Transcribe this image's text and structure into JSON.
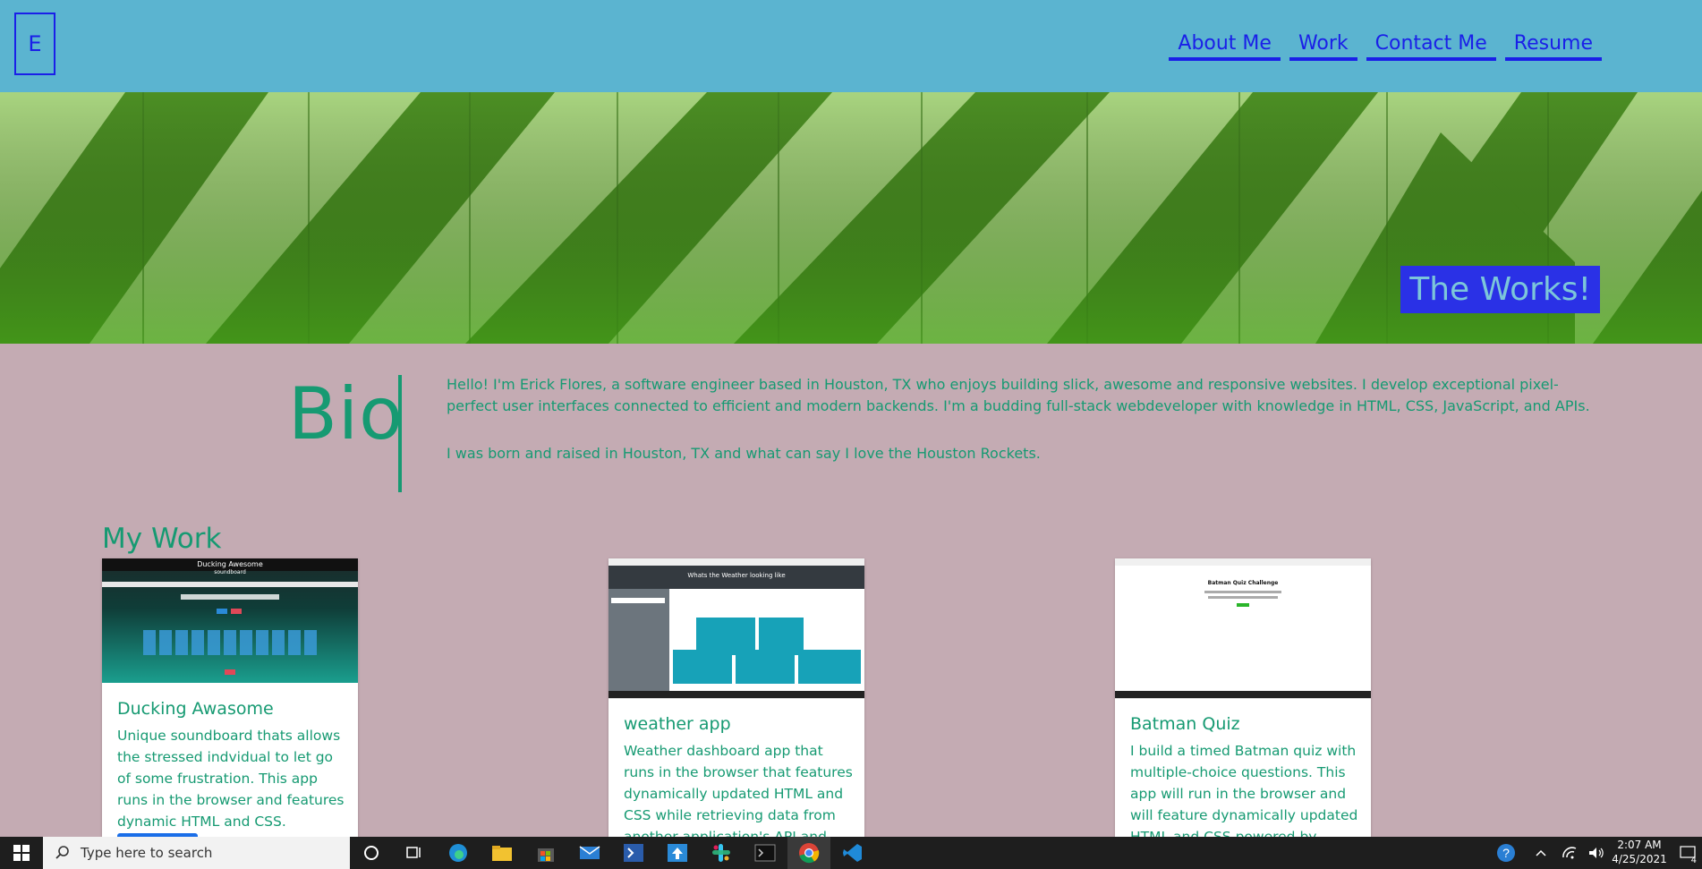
{
  "header": {
    "logo": "E",
    "nav": [
      "About Me",
      "Work",
      "Contact Me",
      "Resume"
    ]
  },
  "hero": {
    "title": "The Works!"
  },
  "bio": {
    "heading": "Bio",
    "paragraphs": [
      "Hello! I'm Erick Flores, a software engineer based in Houston, TX who enjoys building slick, awesome and responsive websites. I develop exceptional pixel-perfect user interfaces connected to efficient and modern backends. I'm a budding full-stack webdeveloper with knowledge in HTML, CSS, JavaScript, and APIs.",
      "I was born and raised in Houston, TX and what can say I love the Houston Rockets."
    ]
  },
  "work": {
    "heading": "My Work",
    "projects": [
      {
        "title": "Ducking Awasome",
        "description": "Unique soundboard thats allows the stressed indvidual to let go of some frustration. This app runs in the browser and features dynamic HTML and CSS.",
        "thumb": {
          "title": "Ducking Awesome",
          "subtitle": "soundboard"
        }
      },
      {
        "title": "weather app",
        "description": "Weather dashboard app that runs in the browser that features dynamically updated HTML and CSS while retrieving data from another application's API and using it in the",
        "thumb": {
          "title": "Whats the Weather looking like"
        }
      },
      {
        "title": "Batman Quiz",
        "description": "I build a timed Batman quiz with multiple-choice questions. This app will run in the browser and will feature dynamically updated HTML and CSS powered by",
        "thumb": {
          "title": "Batman Quiz Challenge"
        }
      }
    ]
  },
  "taskbar": {
    "search_placeholder": "Type here to search",
    "time": "2:07 AM",
    "date": "4/25/2021",
    "notification_count": "4"
  },
  "colors": {
    "header_bg": "#5bb4d0",
    "page_bg": "#c4abb3",
    "accent_blue": "#1a1fe8",
    "text_green": "#169a72"
  }
}
